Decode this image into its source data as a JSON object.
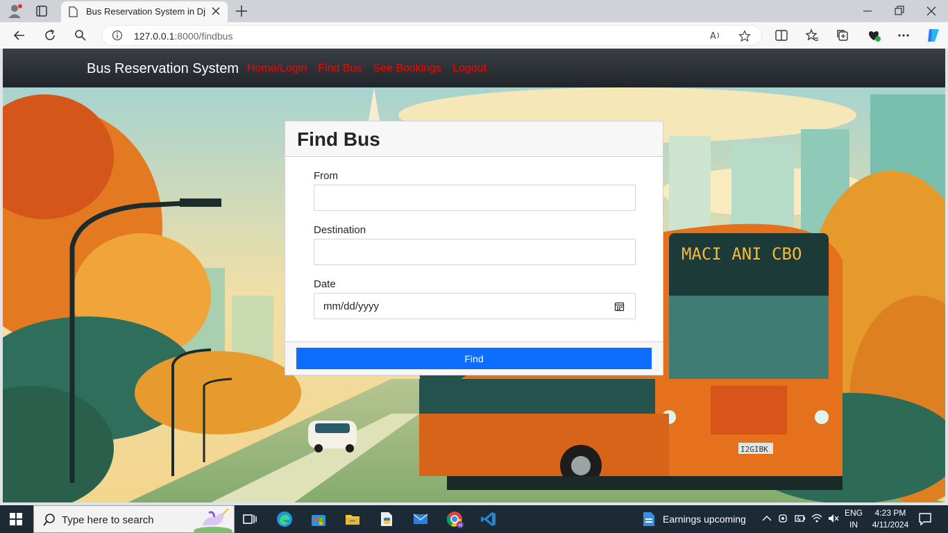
{
  "browser": {
    "tab_title": "Bus Reservation System in Djang",
    "url_host": "127.0.0.1",
    "url_rest": ":8000/findbus"
  },
  "navbar": {
    "brand": "Bus Reservation System",
    "links": [
      "Home/Login",
      "Find Bus",
      "See Bookings",
      "Logout"
    ],
    "link_color": "#ff0000"
  },
  "form": {
    "title": "Find Bus",
    "from_label": "From",
    "from_value": "",
    "destination_label": "Destination",
    "destination_value": "",
    "date_label": "Date",
    "date_placeholder": "mm/dd/yyyy",
    "submit_label": "Find",
    "button_color": "#0d6efd"
  },
  "taskbar": {
    "search_placeholder": "Type here to search",
    "news": "Earnings upcoming",
    "lang_1": "ENG",
    "lang_2": "IN",
    "time": "4:23 PM",
    "date": "4/11/2024"
  }
}
